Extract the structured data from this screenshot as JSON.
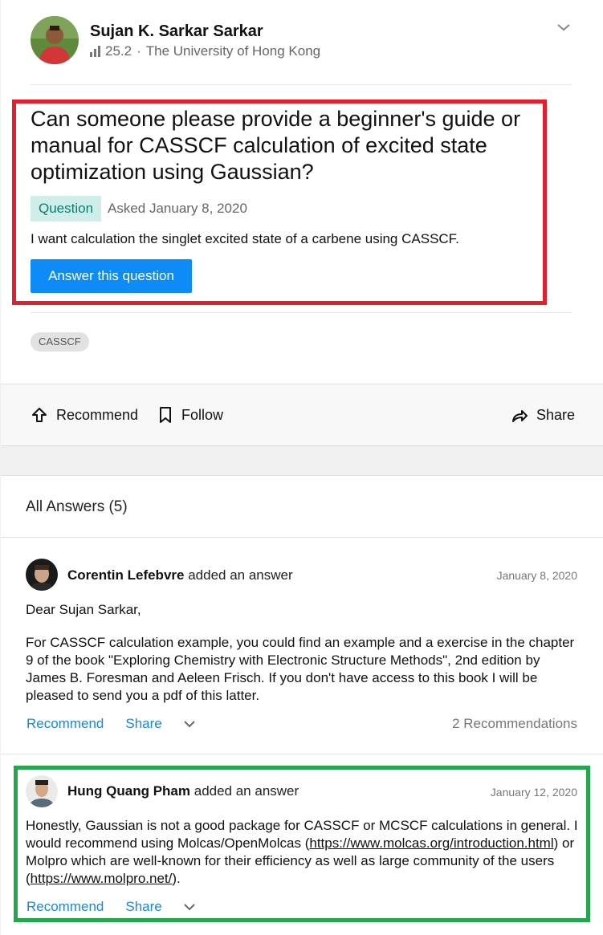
{
  "author": {
    "name": "Sujan K. Sarkar Sarkar",
    "score": "25.2",
    "institution": "The University of Hong Kong",
    "separator": "·"
  },
  "question": {
    "title": "Can someone please provide a beginner's guide or manual for CASSCF calculation of excited state optimization using Gaussian?",
    "badge": "Question",
    "asked": "Asked January 8, 2020",
    "description": "I want calculation the singlet excited state of a carbene using CASSCF.",
    "answer_button": "Answer this question",
    "tags": [
      "CASSCF"
    ]
  },
  "actions": {
    "recommend": "Recommend",
    "follow": "Follow",
    "share": "Share"
  },
  "answers_section": {
    "heading": "All Answers (5)",
    "answers": [
      {
        "author": "Corentin Lefebvre",
        "verb": "added an answer",
        "date": "January 8, 2020",
        "greeting": "Dear Sujan Sarkar,",
        "body": "For CASSCF calculation example, you could find an example and a exercise in the chapter 9 of the book \"Exploring Chemistry with Electronic Structure Methods\", 2nd edition by James B. Foresman and Aeleen Frisch. If you don't have access to this book I will be pleased to send you a pdf of this latter.",
        "recommend": "Recommend",
        "share": "Share",
        "recommendations": "2 Recommendations"
      },
      {
        "author": "Hung Quang Pham",
        "verb": "added an answer",
        "date": "January 12, 2020",
        "body_part1": "Honestly, Gaussian is not a good package for CASSCF or MCSCF calculations in general. I would recommend using Molcas/OpenMolcas (",
        "link1": "https://www.molcas.org/introduction.html",
        "body_part2": ") or Molpro which are well-known for their efficiency as well as large community of the users (",
        "link2": "https://www.molpro.net/",
        "body_part3": ").",
        "recommend": "Recommend",
        "share": "Share"
      }
    ]
  },
  "colors": {
    "highlight_red": "#e0202e",
    "highlight_green": "#22a84a",
    "primary_button": "#0d8cf8",
    "link": "#1a86e0"
  }
}
